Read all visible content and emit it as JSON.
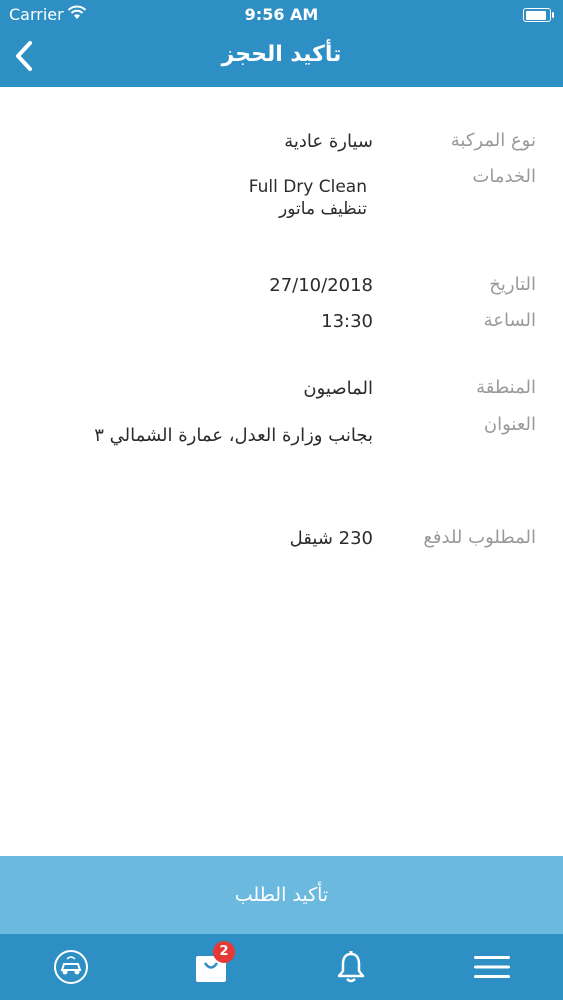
{
  "status_bar": {
    "carrier": "Carrier",
    "time": "9:56 AM"
  },
  "nav": {
    "title": "تأكيد الحجز"
  },
  "details": {
    "vehicle_type_label": "نوع المركبة",
    "vehicle_type_value": "سيارة عادية",
    "services_label": "الخدمات",
    "services": [
      "Full Dry Clean",
      "تنظيف ماتور"
    ],
    "date_label": "التاريخ",
    "date_value": "27/10/2018",
    "time_label": "الساعة",
    "time_value": "13:30",
    "area_label": "المنطقة",
    "area_value": "الماصيون",
    "address_label": "العنوان",
    "address_value": "بجانب وزارة العدل، عمارة الشمالي ٣",
    "amount_label": "المطلوب للدفع",
    "amount_value": "230 شيقل"
  },
  "confirm_button": {
    "label": "تأكيد الطلب"
  },
  "tabbar": {
    "cart_badge": "2",
    "icons": [
      "car-wash-logo-icon",
      "shopping-bag-icon",
      "bell-icon",
      "menu-icon"
    ]
  },
  "colors": {
    "primary": "#2d8fc4",
    "button": "#6cb9e0",
    "badge": "#e53935"
  }
}
